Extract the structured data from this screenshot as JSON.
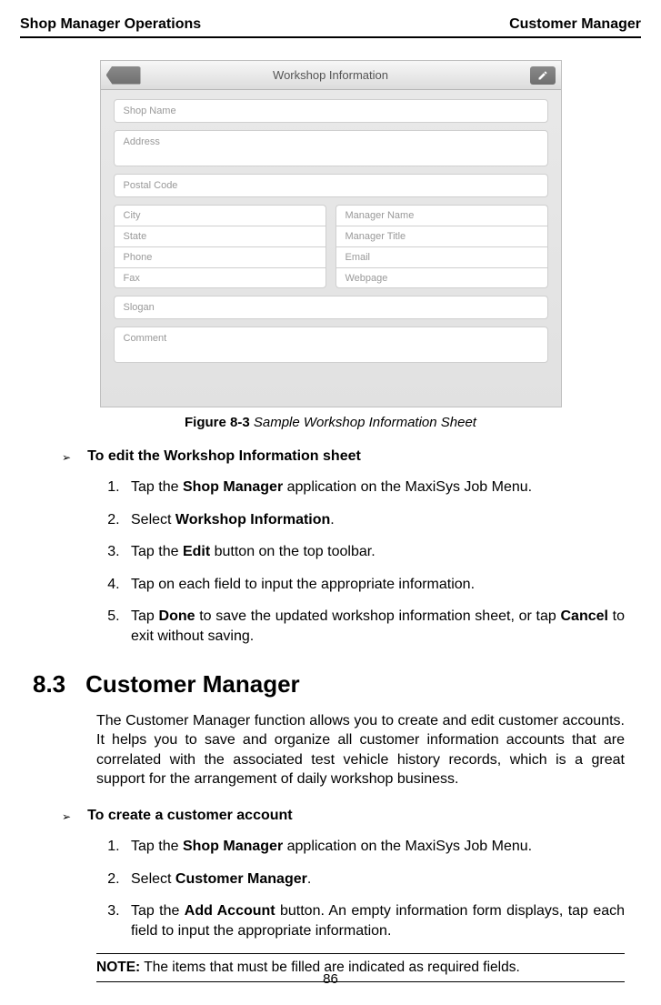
{
  "header": {
    "left": "Shop Manager Operations",
    "right": "Customer Manager"
  },
  "screenshot": {
    "title": "Workshop Information",
    "fields": {
      "shop_name": "Shop Name",
      "address": "Address",
      "postal": "Postal Code",
      "city": "City",
      "state": "State",
      "phone": "Phone",
      "fax": "Fax",
      "mgr_name": "Manager Name",
      "mgr_title": "Manager Title",
      "email": "Email",
      "webpage": "Webpage",
      "slogan": "Slogan",
      "comment": "Comment"
    }
  },
  "caption": {
    "label": "Figure 8-3",
    "text": "Sample Workshop Information Sheet"
  },
  "edit_ws": {
    "heading": "To edit the Workshop Information sheet",
    "steps": {
      "s1a": "Tap the ",
      "s1b": "Shop Manager",
      "s1c": " application on the MaxiSys Job Menu.",
      "s2a": "Select ",
      "s2b": "Workshop Information",
      "s2c": ".",
      "s3a": "Tap the ",
      "s3b": "Edit",
      "s3c": " button on the top toolbar.",
      "s4": "Tap on each field to input the appropriate information.",
      "s5a": "Tap ",
      "s5b": "Done",
      "s5c": " to save the updated workshop information sheet, or tap ",
      "s5d": "Cancel",
      "s5e": " to exit without saving."
    }
  },
  "section": {
    "num": "8.3",
    "title": "Customer Manager"
  },
  "cm_para": "The Customer Manager function allows you to create and edit customer accounts. It helps you to save and organize all customer information accounts that are correlated with the associated test vehicle history records, which is a great support for the arrangement of daily workshop business.",
  "create_acc": {
    "heading": "To create a customer account",
    "steps": {
      "s1a": "Tap the ",
      "s1b": "Shop Manager",
      "s1c": " application on the MaxiSys Job Menu.",
      "s2a": "Select ",
      "s2b": "Customer Manager",
      "s2c": ".",
      "s3a": "Tap the ",
      "s3b": "Add Account",
      "s3c": " button. An empty information form displays, tap each field to input the appropriate information."
    }
  },
  "note": {
    "label": "NOTE:",
    "text": " The items that must be filled are indicated as required fields."
  },
  "page_number": "86"
}
